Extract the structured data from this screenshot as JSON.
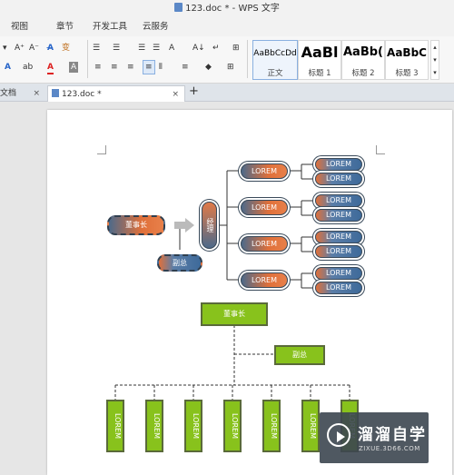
{
  "window": {
    "title": "123.doc * - WPS 文字"
  },
  "menu": [
    "视图",
    "章节",
    "开发工具",
    "云服务"
  ],
  "ribbon": {
    "row1": [
      "A⁺",
      "A⁻",
      "A̶",
      "变",
      "☰",
      "☰",
      "☰",
      "☰",
      "A",
      "A↓",
      "↵",
      "⊞"
    ],
    "row2": [
      "A",
      "ab",
      "A",
      "A",
      "≡",
      "≡",
      "≡",
      "≡",
      "⫴",
      "≡",
      "◆",
      "⊞"
    ],
    "styles": [
      {
        "sample": "AaBbCcDd",
        "name": "正文"
      },
      {
        "sample": "AaBl",
        "name": "标题 1"
      },
      {
        "sample": "AaBb(",
        "name": "标题 2"
      },
      {
        "sample": "AaBbC",
        "name": "标题 3"
      }
    ]
  },
  "tabs": [
    {
      "label": "文档",
      "close": "×"
    },
    {
      "label": "123.doc *",
      "close": "×"
    }
  ],
  "new_tab": "+",
  "diagram": {
    "chairman": "董事长",
    "vice": "副总",
    "manager": "经理",
    "lorem": "LOREM"
  },
  "watermark": {
    "title": "溜溜自学",
    "sub": "ZIXUE.3D66.COM"
  },
  "colors": {
    "orange": "#e0703a",
    "blue": "#3e6a9a",
    "green": "#88c21c"
  }
}
